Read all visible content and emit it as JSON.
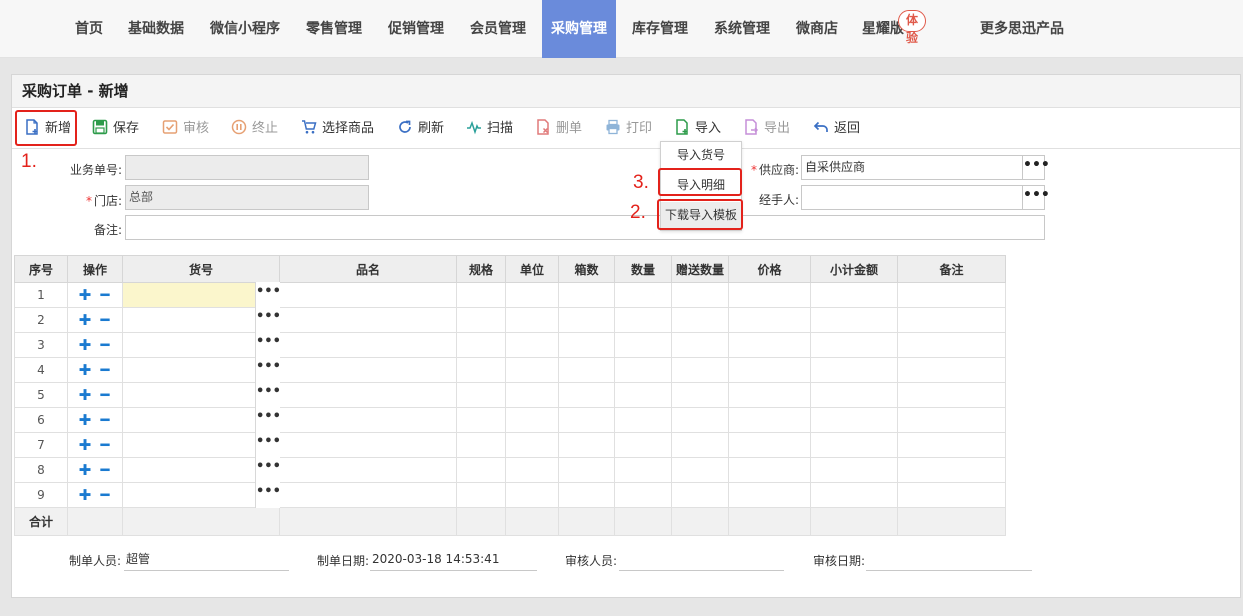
{
  "nav": {
    "items": [
      "首页",
      "基础数据",
      "微信小程序",
      "零售管理",
      "促销管理",
      "会员管理",
      "采购管理",
      "库存管理",
      "系统管理",
      "微商店",
      "星耀版",
      "更多思迅产品"
    ],
    "badge": "体验",
    "active": "采购管理"
  },
  "page": {
    "title": "采购订单 - 新增"
  },
  "toolbar": {
    "new": "新增",
    "save": "保存",
    "audit": "审核",
    "stop": "终止",
    "select_goods": "选择商品",
    "refresh": "刷新",
    "scan": "扫描",
    "delete": "删单",
    "print": "打印",
    "import": "导入",
    "export": "导出",
    "back": "返回"
  },
  "dropdown": {
    "items": [
      "导入货号",
      "导入明细",
      "下载导入模板"
    ]
  },
  "annotations": {
    "a1": "1.",
    "a2": "2.",
    "a3": "3."
  },
  "form": {
    "order_no_label": "业务单号:",
    "order_no_value": "",
    "store_label": "门店:",
    "store_value": "总部",
    "remark_label": "备注:",
    "remark_value": "",
    "supplier_label": "供应商:",
    "supplier_value": "自采供应商",
    "handler_label": "经手人:",
    "handler_value": ""
  },
  "grid": {
    "headers": [
      "序号",
      "操作",
      "货号",
      "品名",
      "规格",
      "单位",
      "箱数",
      "数量",
      "赠送数量",
      "价格",
      "小计金额",
      "备注"
    ],
    "rows": [
      "1",
      "2",
      "3",
      "4",
      "5",
      "6",
      "7",
      "8",
      "9"
    ],
    "op_symbols": "✚ ━",
    "dots": "•••",
    "total_label": "合计"
  },
  "footer": {
    "creator_label": "制单人员:",
    "creator_value": "超管",
    "date_label": "制单日期:",
    "date_value": "2020-03-18 14:53:41",
    "auditor_label": "审核人员:",
    "auditor_value": "",
    "audit_date_label": "审核日期:",
    "audit_date_value": ""
  },
  "colors": {
    "nav_active": "#6a8bdb",
    "annotation_red": "#e3221b",
    "op_blue": "#1a7ad0"
  }
}
